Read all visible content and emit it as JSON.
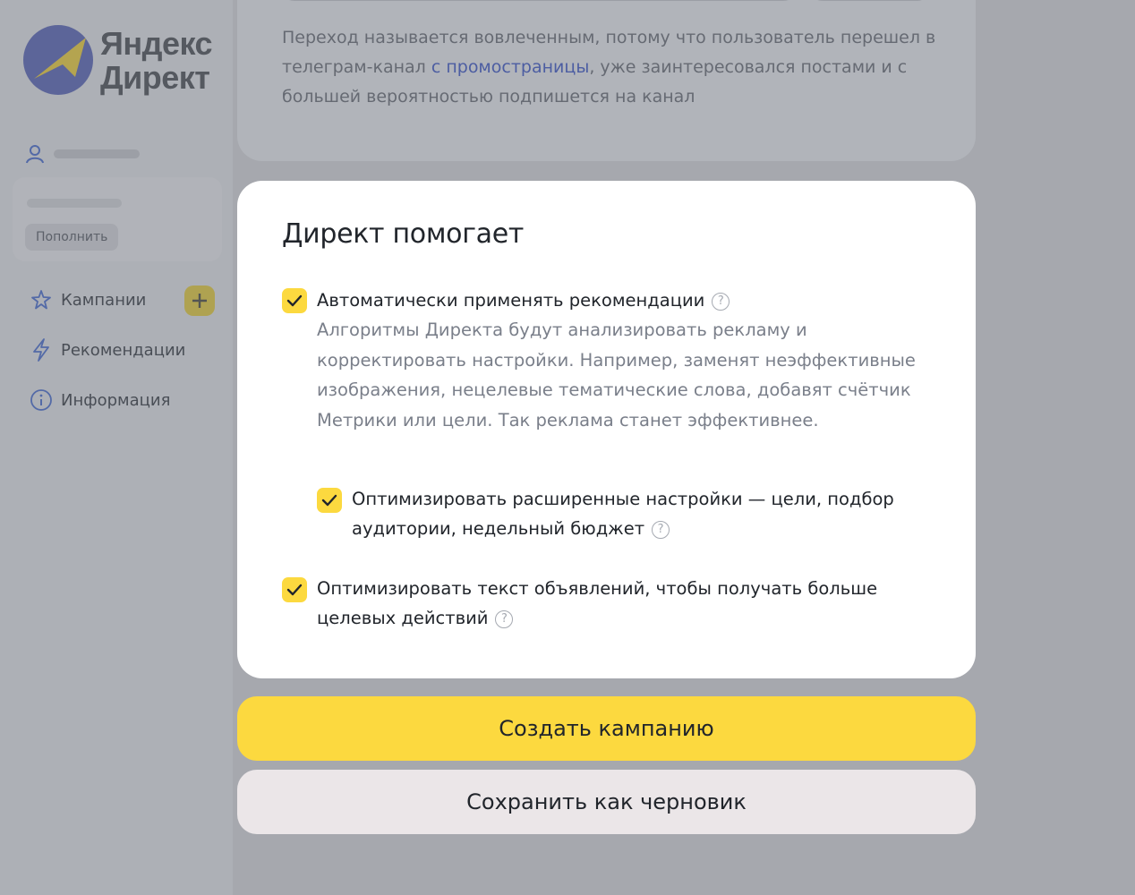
{
  "brand": {
    "logo_line1": "Яндекс",
    "logo_line2": "Директ",
    "accent": "#fcd93f",
    "logo_blue": "#5a66b8"
  },
  "sidebar": {
    "topup_label": "Пополнить",
    "items": [
      {
        "label": "Кампании",
        "icon": "sparkle-star-icon"
      },
      {
        "label": "Рекомендации",
        "icon": "lightning-icon"
      },
      {
        "label": "Информация",
        "icon": "info-circle-icon"
      }
    ]
  },
  "info_card": {
    "text_before": "Переход называется вовлеченным, потому что пользователь перешел в телеграм-канал ",
    "link_text": "с промостраницы",
    "text_after": ", уже заинтересовался постами и с большей вероятностью подпишется на канал"
  },
  "modal": {
    "title": "Директ помогает",
    "options": [
      {
        "label": "Автоматически применять рекомендации",
        "checked": true,
        "description": "Алгоритмы Директа будут анализировать рекламу и корректировать настройки. Например, заменят неэффективные изображения, нецелевые тематические слова, добавят счётчик Метрики или цели. Так реклама станет эффективнее."
      },
      {
        "label": "Оптимизировать расширенные настройки — цели, подбор аудитории, недельный бюджет",
        "checked": true
      },
      {
        "label": "Оптимизировать текст объявлений, чтобы получать больше целевых действий",
        "checked": true
      }
    ]
  },
  "actions": {
    "create_label": "Создать кампанию",
    "draft_label": "Сохранить как черновик"
  }
}
